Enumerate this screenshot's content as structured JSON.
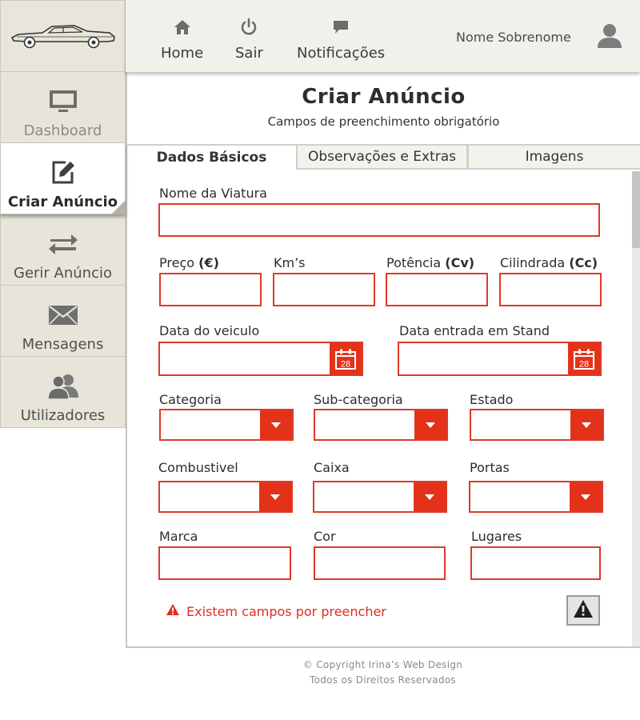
{
  "brand": {
    "logo_icon": "car-icon"
  },
  "sidebar": {
    "items": [
      {
        "label": "Dashboard",
        "icon": "monitor-icon"
      },
      {
        "label": "Criar Anúncio",
        "icon": "edit-icon",
        "active": true
      },
      {
        "label": "Gerir Anúncio",
        "icon": "swap-arrows-icon"
      },
      {
        "label": "Mensagens",
        "icon": "envelope-icon"
      },
      {
        "label": "Utilizadores",
        "icon": "users-icon"
      }
    ]
  },
  "header": {
    "nav": [
      {
        "label": "Home",
        "icon": "home-icon"
      },
      {
        "label": "Sair",
        "icon": "power-icon"
      },
      {
        "label": "Notificações",
        "icon": "chat-icon"
      }
    ],
    "user_name": "Nome Sobrenome",
    "avatar_icon": "user-icon"
  },
  "page": {
    "title": "Criar Anúncio",
    "subtitle": "Campos de preenchimento obrigatório"
  },
  "tabs": [
    {
      "label": "Dados Básicos",
      "active": true
    },
    {
      "label": "Observações e Extras"
    },
    {
      "label": "Imagens"
    }
  ],
  "form": {
    "nome_viatura": {
      "label": "Nome da Viatura",
      "value": ""
    },
    "preco": {
      "label": "Preço",
      "unit": "(€)",
      "value": ""
    },
    "kms": {
      "label": "Km’s",
      "value": ""
    },
    "potencia": {
      "label": "Potência",
      "unit": "(Cv)",
      "value": ""
    },
    "cilindrada": {
      "label": "Cilindrada",
      "unit": "(Cc)",
      "value": ""
    },
    "data_veiculo": {
      "label": "Data do veiculo",
      "value": "",
      "calendar_day": "28"
    },
    "data_entrada": {
      "label": "Data entrada em Stand",
      "value": "",
      "calendar_day": "28"
    },
    "categoria": {
      "label": "Categoria",
      "value": ""
    },
    "subcategoria": {
      "label": "Sub-categoria",
      "value": ""
    },
    "estado": {
      "label": "Estado",
      "value": ""
    },
    "combustivel": {
      "label": "Combustivel",
      "value": ""
    },
    "caixa": {
      "label": "Caixa",
      "value": ""
    },
    "portas": {
      "label": "Portas",
      "value": ""
    },
    "marca": {
      "label": "Marca",
      "value": ""
    },
    "cor": {
      "label": "Cor",
      "value": ""
    },
    "lugares": {
      "label": "Lugares",
      "value": ""
    }
  },
  "validation": {
    "message": "Existem campos por preencher",
    "icon": "warning-icon"
  },
  "footer": {
    "copyright": "© Copyright Irina’s Web Design",
    "rights": "Todos os Direitos Reservados"
  },
  "colors": {
    "accent": "#e33219",
    "error_text": "#e42a1d",
    "sidebar_bg": "#e7e5d9",
    "header_bg": "#f1f0ea"
  }
}
